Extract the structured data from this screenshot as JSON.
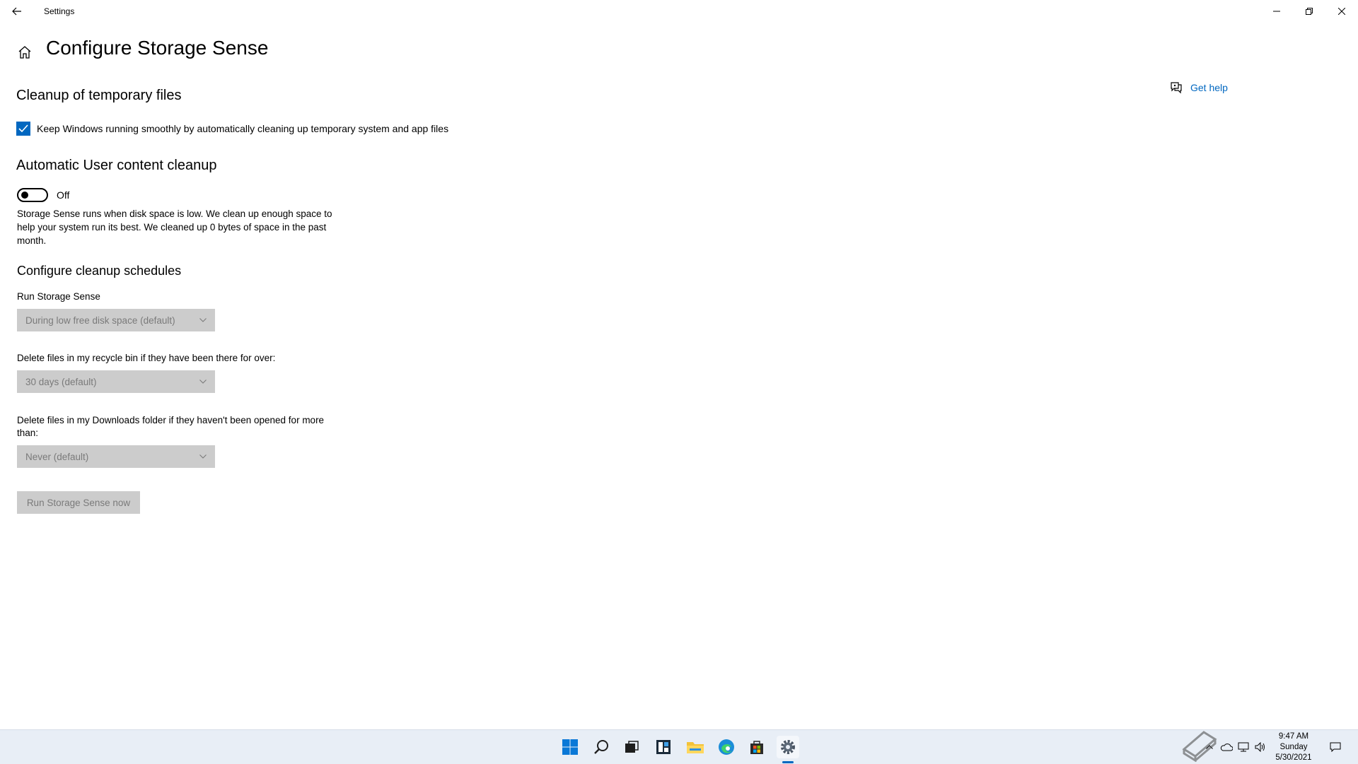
{
  "window": {
    "title": "Settings"
  },
  "page": {
    "title": "Configure Storage Sense",
    "help_label": "Get help"
  },
  "temp_files": {
    "heading": "Cleanup of temporary files",
    "checkbox_label": "Keep Windows running smoothly by automatically cleaning up temporary system and app files",
    "checked": true
  },
  "user_content": {
    "heading": "Automatic User content cleanup",
    "toggle_state": "Off",
    "description": "Storage Sense runs when disk space is low. We clean up enough space to help your system run its best. We cleaned up 0 bytes of space in the past month."
  },
  "schedules": {
    "heading": "Configure cleanup schedules",
    "run_label": "Run Storage Sense",
    "run_value": "During low free disk space (default)",
    "recycle_label": "Delete files in my recycle bin if they have been there for over:",
    "recycle_value": "30 days (default)",
    "downloads_label": "Delete files in my Downloads folder if they haven't been opened for more than:",
    "downloads_value": "Never (default)",
    "run_now_label": "Run Storage Sense now"
  },
  "taskbar": {
    "icons": [
      "start-icon",
      "search-icon",
      "task-view-icon",
      "widgets-icon",
      "file-explorer-icon",
      "edge-icon",
      "store-icon",
      "settings-icon"
    ],
    "active": "settings-icon",
    "clock": {
      "time": "9:47 AM",
      "day": "Sunday",
      "date": "5/30/2021"
    }
  },
  "colors": {
    "accent": "#0067c0",
    "disabled_bg": "#cccccc",
    "disabled_text": "#7a7a7a",
    "taskbar_bg": "#e8eef6"
  }
}
